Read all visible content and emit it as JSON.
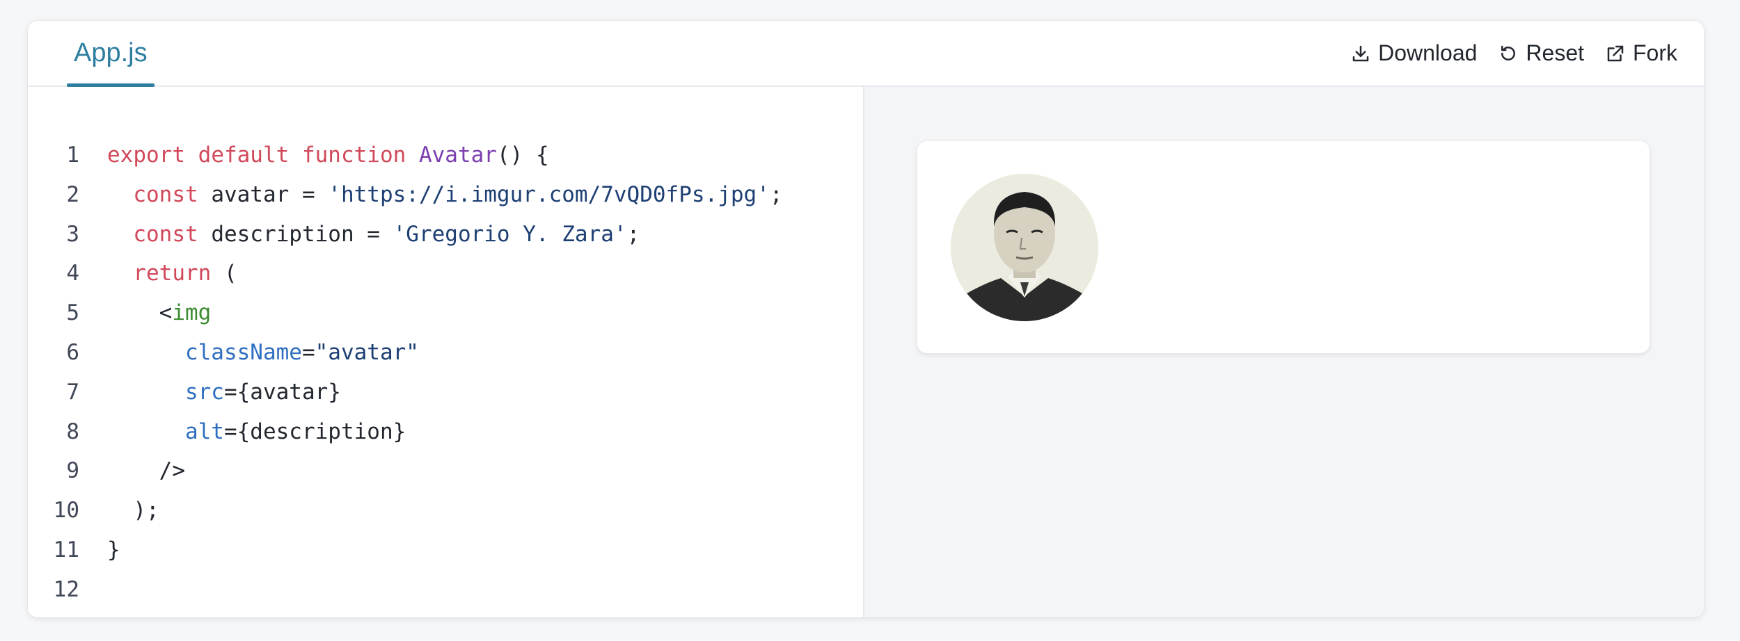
{
  "tab": {
    "label": "App.js"
  },
  "toolbar": {
    "download_label": "Download",
    "reset_label": "Reset",
    "fork_label": "Fork"
  },
  "code": {
    "line_numbers": [
      "1",
      "2",
      "3",
      "4",
      "5",
      "6",
      "7",
      "8",
      "9",
      "10",
      "11",
      "12"
    ],
    "l1": {
      "a": "export",
      "b": " ",
      "c": "default",
      "d": " ",
      "e": "function",
      "f": " ",
      "g": "Avatar",
      "h": "() {"
    },
    "l2": {
      "a": "  ",
      "b": "const",
      "c": " avatar = ",
      "d": "'https://i.imgur.com/7vQD0fPs.jpg'",
      "e": ";"
    },
    "l3": {
      "a": "  ",
      "b": "const",
      "c": " description = ",
      "d": "'Gregorio Y. Zara'",
      "e": ";"
    },
    "l4": {
      "a": "  ",
      "b": "return",
      "c": " ("
    },
    "l5": {
      "a": "    <",
      "b": "img"
    },
    "l6": {
      "a": "      ",
      "b": "className",
      "c": "=",
      "d": "\"avatar\""
    },
    "l7": {
      "a": "      ",
      "b": "src",
      "c": "={avatar}"
    },
    "l8": {
      "a": "      ",
      "b": "alt",
      "c": "={description}"
    },
    "l9": {
      "a": "    />"
    },
    "l10": {
      "a": "  );"
    },
    "l11": {
      "a": "}"
    },
    "l12": {
      "a": ""
    }
  },
  "preview": {
    "avatar_alt": "Gregorio Y. Zara"
  },
  "colors": {
    "accent": "#2f7ea1",
    "keyword": "#d1495b",
    "function": "#7c3fb0",
    "string": "#1d3f73",
    "tag": "#3c8c32",
    "attribute": "#2f6fc1"
  }
}
